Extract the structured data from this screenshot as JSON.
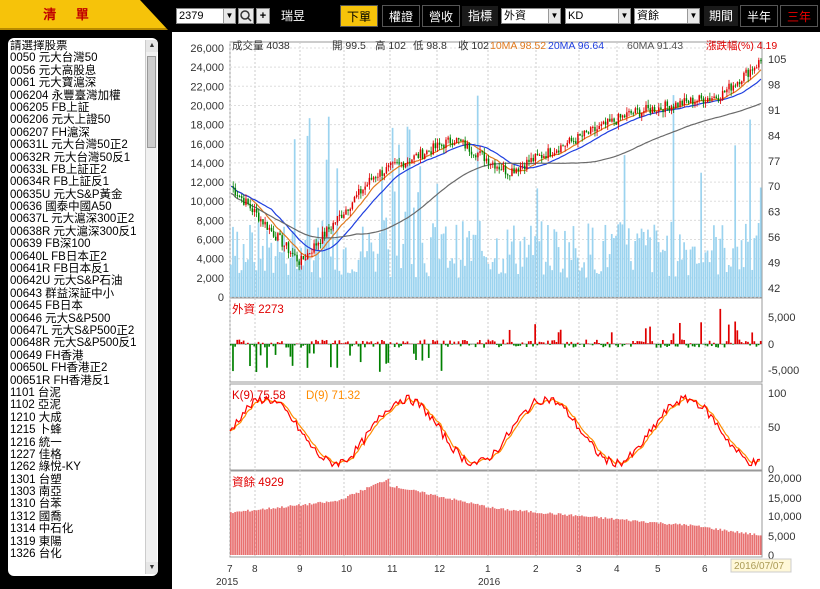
{
  "left_tab": {
    "label": "清 單"
  },
  "stock_list": [
    "請選擇股票",
    "0050  元大台灣50",
    "0056  元大高股息",
    "0061  元大寶滬深",
    "006204  永豐臺灣加權",
    "006205  FB上証",
    "006206  元大上證50",
    "006207  FH滬深",
    "00631L  元大台灣50正2",
    "00632R  元大台灣50反1",
    "00633L  FB上証正2",
    "00634R  FB上証反1",
    "00635U  元大S&P黃金",
    "00636  國泰中國A50",
    "00637L  元大滬深300正2",
    "00638R  元大滬深300反1",
    "00639  FB深100",
    "00640L  FB日本正2",
    "00641R  FB日本反1",
    "00642U  元大S&P石油",
    "00643  群益深証中小",
    "00645  FB日本",
    "00646  元大S&P500",
    "00647L  元大S&P500正2",
    "00648R  元大S&P500反1",
    "00649  FH香港",
    "00650L  FH香港正2",
    "00651R  FH香港反1",
    "1101  台泥",
    "1102  亞泥",
    "1210  大成",
    "1215  卜蜂",
    "1216  統一",
    "1227  佳格",
    "1262  綠悅-KY",
    "1301  台塑",
    "1303  南亞",
    "1310  台苯",
    "1312  國喬",
    "1314  中石化",
    "1319  東陽",
    "1326  台化"
  ],
  "toolbar": {
    "stock_code": "2379",
    "stock_name": "瑞昱",
    "tab_daily": "下單",
    "tab_warrant": "權證",
    "tab_revenue": "營收",
    "indicator_label": "指標",
    "indicator1": "外資",
    "indicator2": "KD",
    "indicator3": "資餘",
    "period_label": "期間",
    "period_half": "半年",
    "period_three": "三年"
  },
  "colors": {
    "ma10": "#e07a1f",
    "ma20": "#1f3fdf",
    "ma60": "#6a6a6a",
    "up": "#e00000",
    "down": "#008000",
    "volume": "#9bd3ef",
    "k": "#ff0000",
    "d": "#ff8c00",
    "margin": "#e87070"
  },
  "main_panel": {
    "volume_label": "成交量 4038",
    "open": "開 99.5",
    "high": "高 102",
    "low": "低 98.8",
    "close": "收 102",
    "ma10": "10MA 98.52",
    "ma20": "20MA 96.64",
    "ma60": "60MA 91.43",
    "change": "漲跌幅(%) 4.19",
    "left_ticks": [
      "26,000",
      "24,000",
      "22,000",
      "20,000",
      "18,000",
      "16,000",
      "14,000",
      "12,000",
      "10,000",
      "8,000",
      "6,000",
      "4,000",
      "2,000",
      "0"
    ],
    "right_ticks": [
      "105",
      "98",
      "91",
      "84",
      "77",
      "70",
      "63",
      "56",
      "49",
      "42"
    ]
  },
  "foreign_panel": {
    "label": "外資 2273",
    "ticks": [
      "5,000",
      "0",
      "-5,000"
    ]
  },
  "kd_panel": {
    "k_label": "K(9) 75.58",
    "d_label": "D(9) 71.32",
    "ticks": [
      "100",
      "50",
      "0"
    ]
  },
  "margin_panel": {
    "label": "資餘 4929",
    "ticks": [
      "20,000",
      "15,000",
      "10,000",
      "5,000",
      "0"
    ]
  },
  "x_axis": {
    "months": [
      "7",
      "8",
      "9",
      "10",
      "11",
      "12",
      "1",
      "2",
      "3",
      "4",
      "5",
      "6"
    ],
    "year_2015": "2015",
    "year_2016": "2016",
    "date_box": "2016/07/07"
  }
}
